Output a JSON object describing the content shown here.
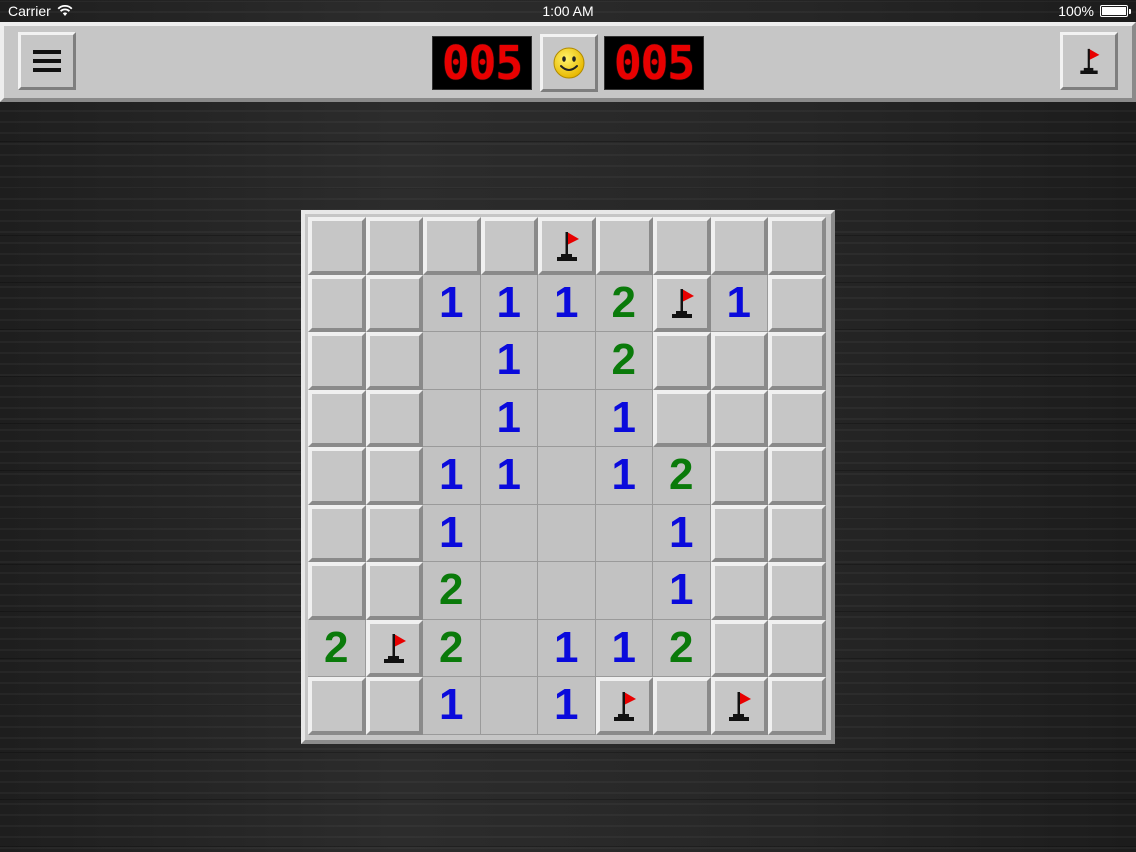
{
  "status_bar": {
    "carrier": "Carrier",
    "time": "1:00 AM",
    "battery": "100%"
  },
  "toolbar": {
    "mine_counter": "005",
    "timer": "005",
    "face_state": "smile",
    "menu_icon": "hamburger-icon",
    "flag_mode_icon": "flag-icon"
  },
  "colors": {
    "number_1": "#0a0adc",
    "number_2": "#0a7a0a",
    "lcd_digit": "#e80000",
    "flag": "#e80000"
  },
  "board": {
    "rows": 9,
    "cols": 9,
    "legend": "C = covered, F = flagged, E = opened empty, digit = opened number",
    "grid": [
      [
        "C",
        "C",
        "C",
        "C",
        "F",
        "C",
        "C",
        "C",
        "C"
      ],
      [
        "C",
        "C",
        "1",
        "1",
        "1",
        "2",
        "F",
        "1",
        "C"
      ],
      [
        "C",
        "C",
        "E",
        "1",
        "E",
        "2",
        "C",
        "C",
        "C"
      ],
      [
        "C",
        "C",
        "E",
        "1",
        "E",
        "1",
        "C",
        "C",
        "C"
      ],
      [
        "C",
        "C",
        "1",
        "1",
        "E",
        "1",
        "2",
        "C",
        "C"
      ],
      [
        "C",
        "C",
        "1",
        "E",
        "E",
        "E",
        "1",
        "C",
        "C"
      ],
      [
        "C",
        "C",
        "2",
        "E",
        "E",
        "E",
        "1",
        "C",
        "C"
      ],
      [
        "2",
        "F",
        "2",
        "E",
        "1",
        "1",
        "2",
        "C",
        "C"
      ],
      [
        "C",
        "C",
        "1",
        "E",
        "1",
        "F",
        "C",
        "F",
        "C"
      ]
    ]
  }
}
